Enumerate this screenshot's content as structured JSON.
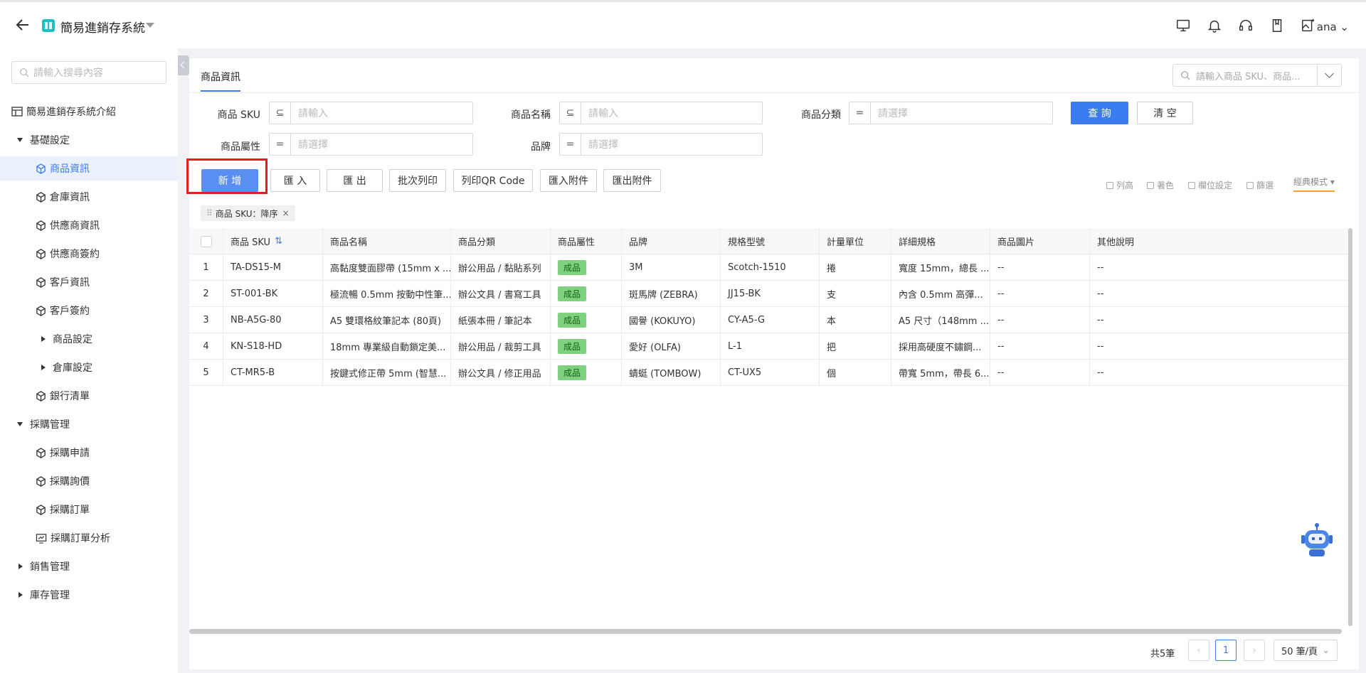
{
  "header": {
    "app_title": "簡易進銷存系統",
    "user": "ana"
  },
  "sidebar": {
    "search_placeholder": "請輸入搜尋內容",
    "items": [
      {
        "label": "簡易進銷存系統介紹"
      },
      {
        "label": "基礎設定"
      },
      {
        "label": "商品資訊"
      },
      {
        "label": "倉庫資訊"
      },
      {
        "label": "供應商資訊"
      },
      {
        "label": "供應商簽約"
      },
      {
        "label": "客戶資訊"
      },
      {
        "label": "客戶簽約"
      },
      {
        "label": "商品設定"
      },
      {
        "label": "倉庫設定"
      },
      {
        "label": "銀行清單"
      },
      {
        "label": "採購管理"
      },
      {
        "label": "採購申請"
      },
      {
        "label": "採購詢價"
      },
      {
        "label": "採購訂單"
      },
      {
        "label": "採購訂單分析"
      },
      {
        "label": "銷售管理"
      },
      {
        "label": "庫存管理"
      }
    ]
  },
  "main": {
    "tab": "商品資訊",
    "global_search_placeholder": "請輸入商品 SKU、商品...",
    "filters": {
      "sku_label": "商品 SKU",
      "sku_placeholder": "請輸入",
      "name_label": "商品名稱",
      "name_placeholder": "請輸入",
      "category_label": "商品分類",
      "category_placeholder": "請選擇",
      "attr_label": "商品屬性",
      "attr_placeholder": "請選擇",
      "brand_label": "品牌",
      "brand_placeholder": "請選擇",
      "op_like": "⊆",
      "op_eq": "="
    },
    "query_button": "查 詢",
    "clear_button": "清 空",
    "toolbar": {
      "add": "新 增",
      "import": "匯 入",
      "export": "匯 出",
      "batch_print": "批次列印",
      "print_qr": "列印QR Code",
      "import_attach": "匯入附件",
      "export_attach": "匯出附件",
      "row_height": "列高",
      "color": "著色",
      "column_settings": "欄位設定",
      "filter": "篩選",
      "mode": "經典模式"
    },
    "sort_tag": "商品 SKU：降序",
    "table": {
      "headers": [
        "商品 SKU",
        "商品名稱",
        "商品分類",
        "商品屬性",
        "品牌",
        "規格型號",
        "計量單位",
        "詳細規格",
        "商品圖片",
        "其他說明"
      ],
      "rows": [
        {
          "no": "1",
          "sku": "TA-DS15-M",
          "name": "高黏度雙面膠帶 (15mm x ...",
          "category": "辦公用品 / 黏貼系列",
          "attr": "成品",
          "brand": "3M",
          "model": "Scotch-1510",
          "unit": "捲",
          "spec": "寬度 15mm，總長 ...",
          "image": "--",
          "note": "--"
        },
        {
          "no": "2",
          "sku": "ST-001-BK",
          "name": "極流暢 0.5mm 按動中性筆...",
          "category": "辦公文具 / 書寫工具",
          "attr": "成品",
          "brand": "斑馬牌 (ZEBRA)",
          "model": "JJ15-BK",
          "unit": "支",
          "spec": "內含 0.5mm 高彈...",
          "image": "--",
          "note": "--"
        },
        {
          "no": "3",
          "sku": "NB-A5G-80",
          "name": "A5 雙環格紋筆記本 (80頁)",
          "category": "紙張本冊 / 筆記本",
          "attr": "成品",
          "brand": "國譽 (KOKUYO)",
          "model": "CY-A5-G",
          "unit": "本",
          "spec": "A5 尺寸（148mm ...",
          "image": "--",
          "note": "--"
        },
        {
          "no": "4",
          "sku": "KN-S18-HD",
          "name": "18mm 專業級自動鎖定美...",
          "category": "辦公用品 / 裁剪工具",
          "attr": "成品",
          "brand": "愛好 (OLFA)",
          "model": "L-1",
          "unit": "把",
          "spec": "採用高硬度不鏽鋼...",
          "image": "--",
          "note": "--"
        },
        {
          "no": "5",
          "sku": "CT-MR5-B",
          "name": "按鍵式修正帶 5mm (智慧...",
          "category": "辦公文具 / 修正用品",
          "attr": "成品",
          "brand": "蜻蜓 (TOMBOW)",
          "model": "CT-UX5",
          "unit": "個",
          "spec": "帶寬 5mm，帶長 6...",
          "image": "--",
          "note": "--"
        }
      ]
    },
    "pager": {
      "total": "共5筆",
      "current_page": "1",
      "page_size": "50 筆/頁"
    }
  }
}
